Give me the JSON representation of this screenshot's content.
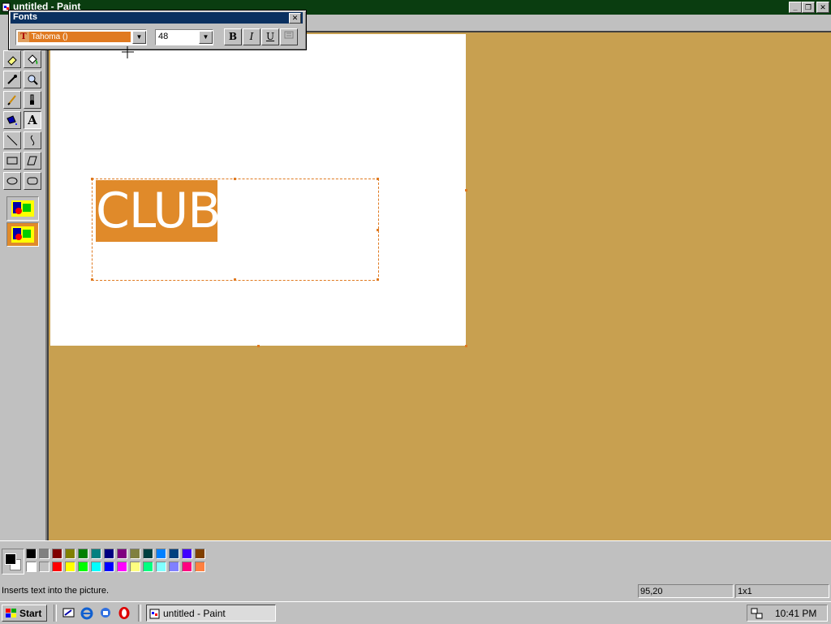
{
  "window": {
    "title": "untitled - Paint",
    "controls": [
      "minimize",
      "restore",
      "close"
    ]
  },
  "fonts_toolbar": {
    "title": "Fonts",
    "font_name": "Tahoma ()",
    "font_size": "48",
    "bold_label": "B",
    "italic_label": "I",
    "underline_label": "U"
  },
  "canvas": {
    "text": "CLUB",
    "text_bg": "#e08a2a",
    "text_color": "#ffffff"
  },
  "workspace_bg": "#c8a050",
  "toolbox": {
    "tools": [
      "free-form-select",
      "select",
      "eraser",
      "fill-with-color",
      "pick-color",
      "magnifier",
      "pencil",
      "brush",
      "airbrush",
      "text",
      "line",
      "curve",
      "rectangle",
      "polygon",
      "ellipse",
      "rounded-rectangle"
    ],
    "active_tool": "text",
    "text_tool_label": "A",
    "options": [
      "opaque",
      "transparent"
    ]
  },
  "palette": {
    "foreground": "#000000",
    "background": "#ffffff",
    "row1": [
      "#000000",
      "#808080",
      "#800000",
      "#808000",
      "#008000",
      "#008080",
      "#000080",
      "#800080",
      "#808040",
      "#004040",
      "#0080ff",
      "#004080",
      "#4000ff",
      "#804000"
    ],
    "row2": [
      "#ffffff",
      "#c0c0c0",
      "#ff0000",
      "#ffff00",
      "#00ff00",
      "#00ffff",
      "#0000ff",
      "#ff00ff",
      "#ffff80",
      "#00ff80",
      "#80ffff",
      "#8080ff",
      "#ff0080",
      "#ff8040"
    ]
  },
  "statusbar": {
    "hint": "Inserts text into the picture.",
    "coords": "95,20",
    "size": "1x1"
  },
  "taskbar": {
    "start_label": "Start",
    "task_label": "untitled - Paint",
    "clock": "10:41 PM"
  }
}
